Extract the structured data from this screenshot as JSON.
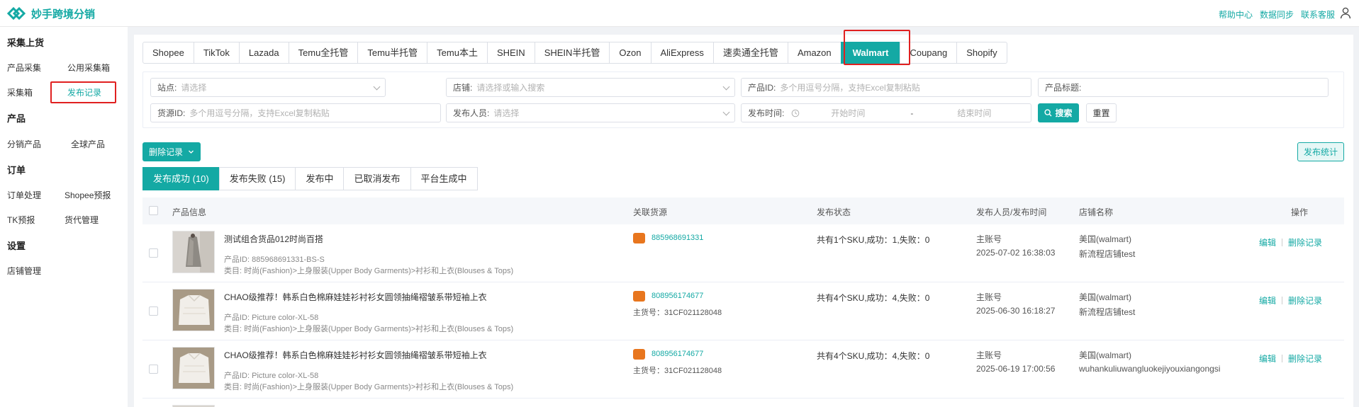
{
  "app": {
    "title": "妙手跨境分销"
  },
  "header_links": [
    "帮助中心",
    "数据同步",
    "联系客服"
  ],
  "sidebar": {
    "sections": [
      {
        "title": "采集上货",
        "items": [
          "产品采集",
          "公用采集箱",
          "采集箱",
          "发布记录"
        ]
      },
      {
        "title": "产品",
        "items": [
          "分销产品",
          "全球产品"
        ]
      },
      {
        "title": "订单",
        "items": [
          "订单处理",
          "Shopee预报",
          "TK预报",
          "货代管理"
        ]
      },
      {
        "title": "设置",
        "items": [
          "店铺管理"
        ]
      }
    ],
    "active_item": "发布记录"
  },
  "platform_tabs": [
    "Shopee",
    "TikTok",
    "Lazada",
    "Temu全托管",
    "Temu半托管",
    "Temu本土",
    "SHEIN",
    "SHEIN半托管",
    "Ozon",
    "AliExpress",
    "速卖通全托管",
    "Amazon",
    "Walmart",
    "Coupang",
    "Shopify"
  ],
  "active_platform": "Walmart",
  "filters": {
    "site": {
      "label": "站点:",
      "placeholder": "请选择"
    },
    "shop": {
      "label": "店铺:",
      "placeholder": "请选择或输入搜索"
    },
    "product_id": {
      "label": "产品ID:",
      "placeholder": "多个用逗号分隔，支持Excel复制粘贴"
    },
    "product_title": {
      "label": "产品标题:",
      "placeholder": ""
    },
    "source_id": {
      "label": "货源ID:",
      "placeholder": "多个用逗号分隔，支持Excel复制粘贴"
    },
    "publisher": {
      "label": "发布人员:",
      "placeholder": "请选择"
    },
    "publish_time": {
      "label": "发布时间:",
      "start_placeholder": "开始时间",
      "separator": "-",
      "end_placeholder": "结束时间"
    },
    "search_label": "搜索",
    "reset_label": "重置"
  },
  "actions": {
    "delete_records": "删除记录",
    "publish_stats": "发布统计"
  },
  "status_tabs": [
    "发布成功 (10)",
    "发布失败 (15)",
    "发布中",
    "已取消发布",
    "平台生成中"
  ],
  "table": {
    "headers": [
      "产品信息",
      "关联货源",
      "发布状态",
      "发布人员/发布时间",
      "店铺名称",
      "操作"
    ],
    "rows": [
      {
        "title": "测试组合货品012时尚百搭",
        "product_id": "产品ID: 885968691331-BS-S",
        "category": "类目: 时尚(Fashion)>上身服装(Upper Body Garments)>衬衫和上衣(Blouses & Tops)",
        "source_id": "885968691331",
        "main_sku": "",
        "status": "共有1个SKU,成功：1,失败：0",
        "publisher": "主账号",
        "time": "2025-07-02 16:38:03",
        "shop_region": "美国(walmart)",
        "shop_name": "新流程店铺test",
        "thumb": "coat"
      },
      {
        "title": "CHAO级推荐！韩系白色棉麻娃娃衫衬衫女圆领抽绳褶皱系带短袖上衣",
        "product_id": "产品ID: Picture color-XL-58",
        "category": "类目: 时尚(Fashion)>上身服装(Upper Body Garments)>衬衫和上衣(Blouses & Tops)",
        "source_id": "808956174677",
        "main_sku": "主货号：31CF021128048",
        "status": "共有4个SKU,成功：4,失败：0",
        "publisher": "主账号",
        "time": "2025-06-30 16:18:27",
        "shop_region": "美国(walmart)",
        "shop_name": "新流程店铺test",
        "thumb": "shirt"
      },
      {
        "title": "CHAO级推荐！韩系白色棉麻娃娃衫衬衫女圆领抽绳褶皱系带短袖上衣",
        "product_id": "产品ID: Picture color-XL-58",
        "category": "类目: 时尚(Fashion)>上身服装(Upper Body Garments)>衬衫和上衣(Blouses & Tops)",
        "source_id": "808956174677",
        "main_sku": "主货号：31CF021128048",
        "status": "共有4个SKU,成功：4,失败：0",
        "publisher": "主账号",
        "time": "2025-06-19 17:00:56",
        "shop_region": "美国(walmart)",
        "shop_name": "wuhankuliuwangluokejiyouxiangongsi",
        "thumb": "shirt"
      }
    ],
    "row_actions": [
      "编辑",
      "删除记录"
    ]
  },
  "colors": {
    "accent": "#14a9a4",
    "highlight_box": "#e02020",
    "source_icon": "#e8761e"
  }
}
